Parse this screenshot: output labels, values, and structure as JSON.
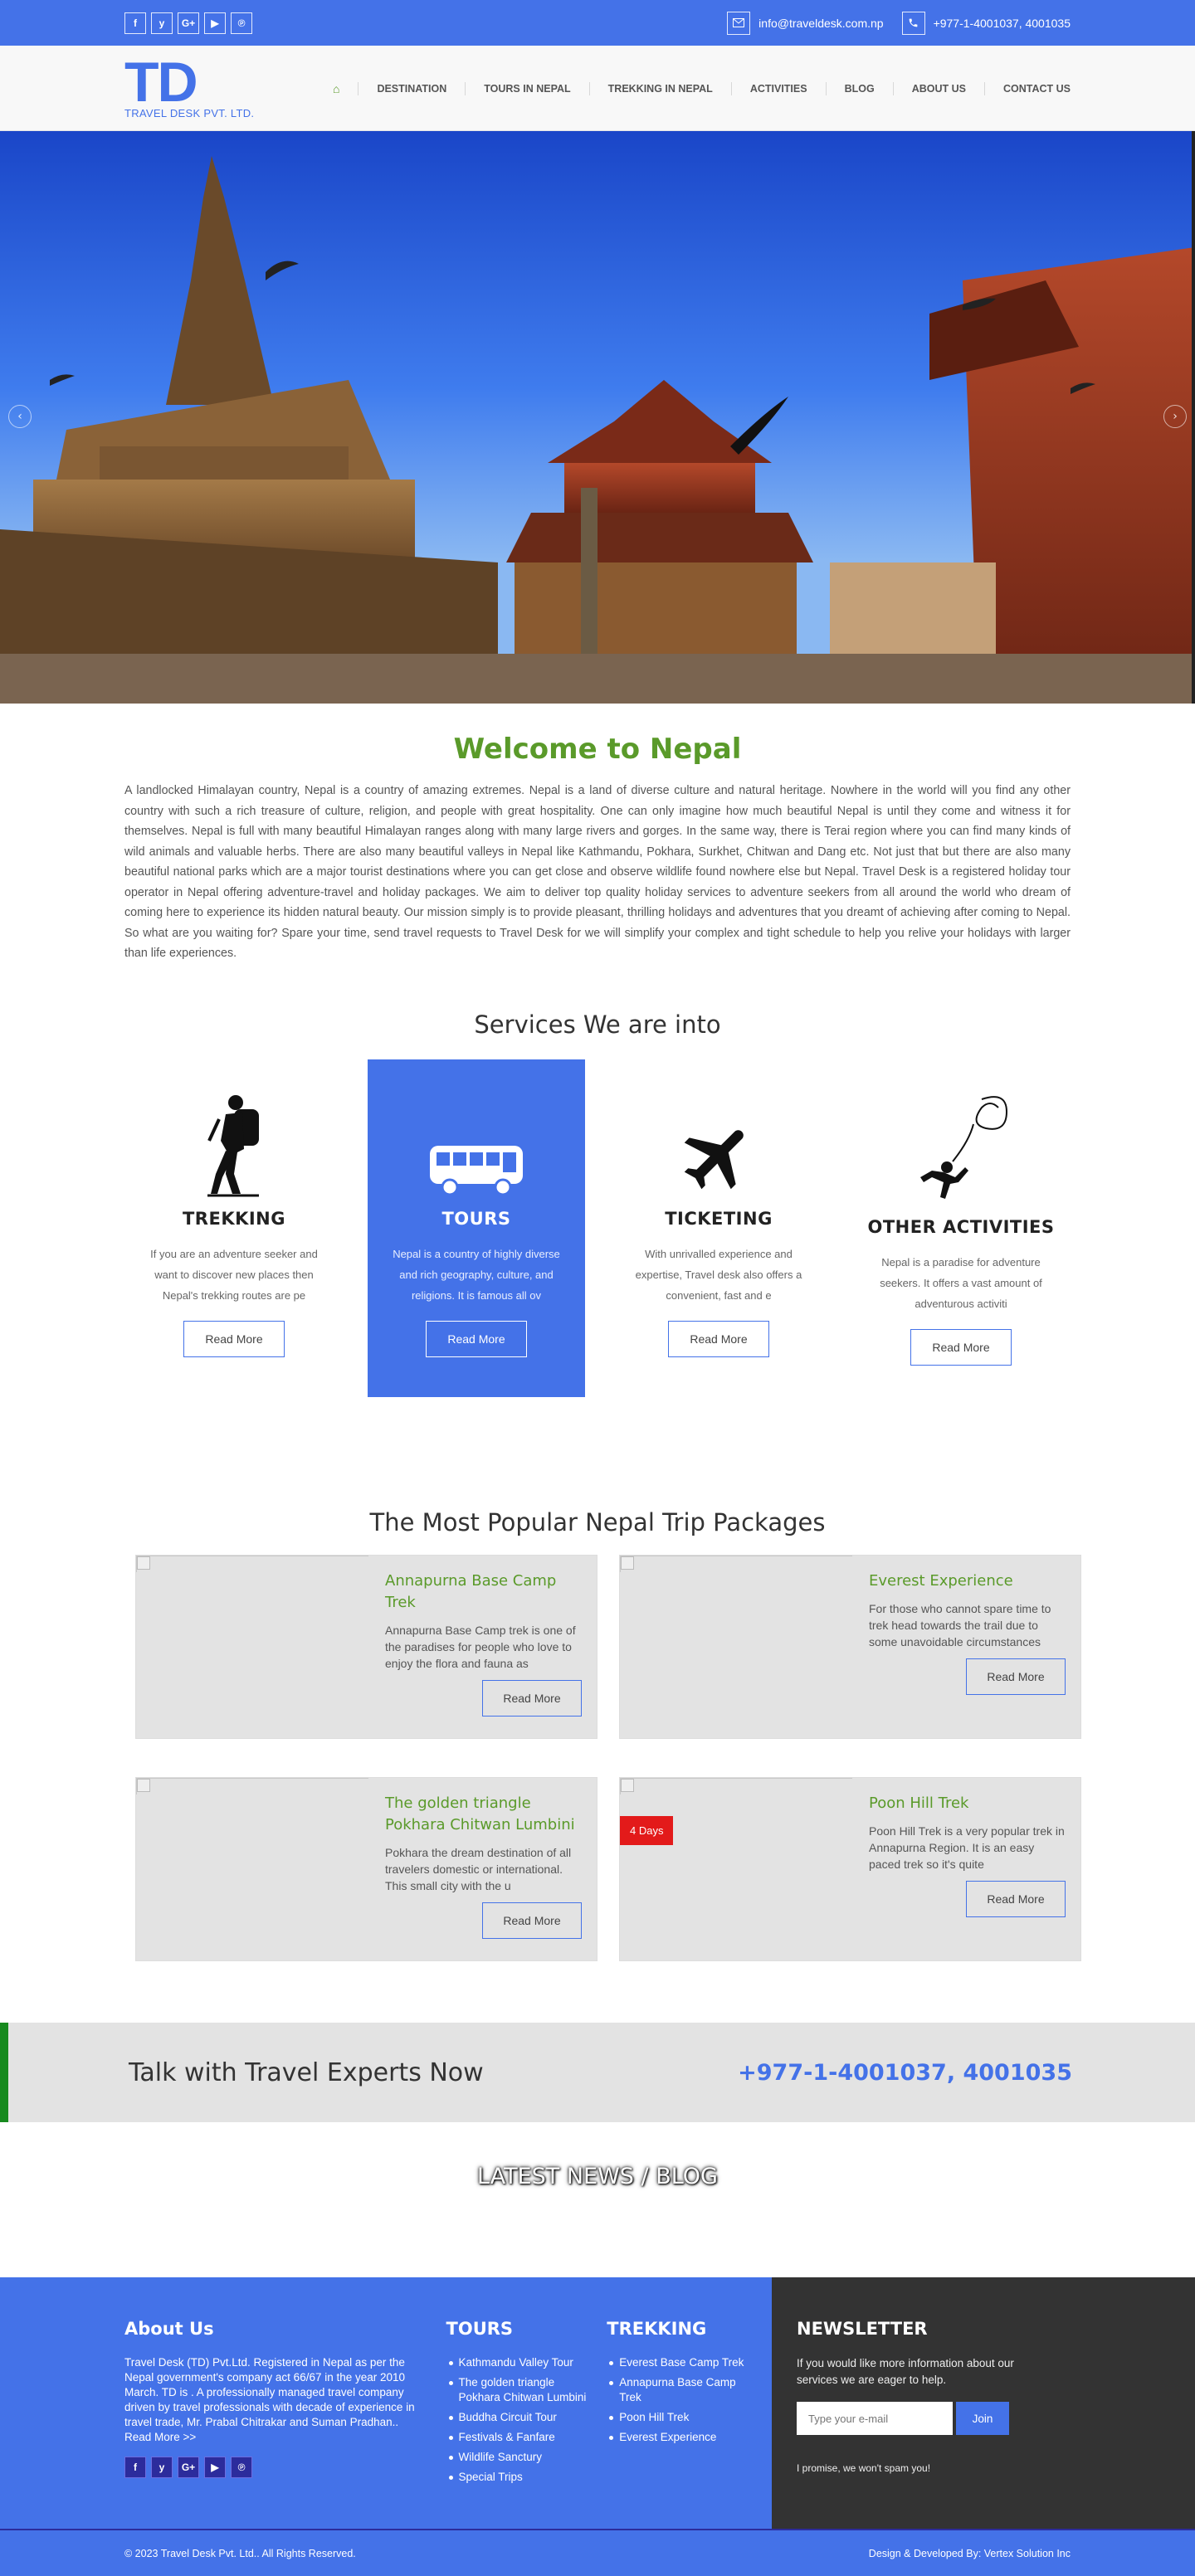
{
  "topbar": {
    "social": [
      {
        "icon": "facebook-icon",
        "glyph": "f"
      },
      {
        "icon": "twitter-icon",
        "glyph": "y"
      },
      {
        "icon": "google-plus-icon",
        "glyph": "G+"
      },
      {
        "icon": "youtube-icon",
        "glyph": "▶"
      },
      {
        "icon": "pinterest-icon",
        "glyph": "℗"
      }
    ],
    "email": "info@traveldesk.com.np",
    "phone": "+977-1-4001037, 4001035"
  },
  "header": {
    "logo_mark": "TD",
    "logo_sub": "TRAVEL DESK PVT. LTD.",
    "nav": [
      {
        "label": "⌂",
        "name": "home"
      },
      {
        "label": "DESTINATION",
        "name": "destination"
      },
      {
        "label": "TOURS IN NEPAL",
        "name": "tours-in-nepal"
      },
      {
        "label": "TREKKING IN NEPAL",
        "name": "trekking-in-nepal"
      },
      {
        "label": "ACTIVITIES",
        "name": "activities"
      },
      {
        "label": "BLOG",
        "name": "blog"
      },
      {
        "label": "ABOUT US",
        "name": "about-us"
      },
      {
        "label": "CONTACT US",
        "name": "contact-us"
      }
    ]
  },
  "hero": {
    "prev": "‹",
    "next": "›"
  },
  "welcome": {
    "title": "Welcome to Nepal",
    "text": "A landlocked Himalayan country, Nepal is a country of amazing extremes. Nepal is a land of diverse culture and natural heritage. Nowhere in the world will you find any other country with such a rich treasure of culture, religion, and people with great hospitality. One can only imagine how much beautiful Nepal is until they come and witness it for themselves. Nepal is full with many beautiful Himalayan ranges along with many large rivers and gorges. In the same way, there is Terai region where you can find many kinds of wild animals and valuable herbs. There are also many beautiful valleys in Nepal like Kathmandu, Pokhara, Surkhet, Chitwan and Dang etc. Not just that but there are also many beautiful national parks which are a major tourist destinations where you can get close and observe wildlife found nowhere else but Nepal. Travel Desk is a registered holiday tour operator in Nepal offering adventure-travel and holiday packages. We aim to deliver top quality holiday services to adventure seekers from all around the world who dream of coming here to experience its hidden natural beauty. Our mission simply is to provide pleasant, thrilling holidays and adventures that you dreamt of achieving after coming to Nepal. So what are you waiting for? Spare your time, send travel requests to Travel Desk for we will simplify your complex and tight schedule to help you relive your holidays with larger than life experiences."
  },
  "services": {
    "title": "Services We are into",
    "items": [
      {
        "name": "trekking",
        "icon": "hiker-icon",
        "title": "TREKKING",
        "text": "If you are an adventure seeker and want to discover new places then Nepal's trekking routes are pe",
        "button": "Read More"
      },
      {
        "name": "tours",
        "icon": "bus-icon",
        "title": "TOURS",
        "text": "Nepal is a country of highly diverse and rich geography, culture, and religions. It is famous all ov",
        "button": "Read More"
      },
      {
        "name": "ticketing",
        "icon": "airplane-icon",
        "title": "TICKETING",
        "text": "With unrivalled experience and expertise, Travel desk also offers a convenient, fast and e",
        "button": "Read More"
      },
      {
        "name": "other-activities",
        "icon": "bungee-icon",
        "title": "OTHER ACTIVITIES",
        "text": "Nepal is a paradise for adventure seekers. It offers a vast amount of adventurous activiti",
        "button": "Read More"
      }
    ]
  },
  "packages": {
    "title": "The Most Popular Nepal Trip Packages",
    "items": [
      {
        "title": "Annapurna Base Camp Trek",
        "text": "Annapurna Base Camp trek is one of the paradises for people who love to enjoy the flora and fauna as",
        "button": "Read More",
        "badge": ""
      },
      {
        "title": "Everest Experience",
        "text": "For those who cannot spare time to trek head towards the trail due to some unavoidable circumstances",
        "button": "Read More",
        "badge": ""
      },
      {
        "title": "The golden triangle Pokhara Chitwan Lumbini",
        "text": "Pokhara the dream destination of all travelers domestic or international. This small city with the u",
        "button": "Read More",
        "badge": ""
      },
      {
        "title": "Poon Hill Trek",
        "text": "Poon Hill Trek is a very popular trek in Annapurna Region. It is an easy paced trek so it's quite",
        "button": "Read More",
        "badge": "4 Days"
      }
    ]
  },
  "talk": {
    "lead": "Talk with Travel Experts Now",
    "phone": "+977-1-4001037, 4001035"
  },
  "blog": {
    "title": "LATEST NEWS / BLOG"
  },
  "footer": {
    "about": {
      "title": "About Us",
      "text": "Travel Desk (TD) Pvt.Ltd. Registered in Nepal as per the Nepal government's company act 66/67 in the year 2010 March. TD is . A professionally managed travel company driven by travel professionals with decade of experience in travel trade, Mr. Prabal Chitrakar and Suman Pradhan.. Read More >>"
    },
    "tours": {
      "title": "TOURS",
      "items": [
        "Kathmandu Valley Tour",
        "The golden triangle Pokhara Chitwan Lumbini",
        "Buddha Circuit Tour",
        "Festivals & Fanfare",
        "Wildlife Sanctury",
        "Special Trips"
      ]
    },
    "trekking": {
      "title": "TREKKING",
      "items": [
        "Everest Base Camp Trek",
        "Annapurna Base Camp Trek",
        "Poon Hill Trek",
        "Everest Experience"
      ]
    },
    "newsletter": {
      "title": "NEWSLETTER",
      "text": "If you would like more information about our services we are eager to help.",
      "placeholder": "Type your e-mail",
      "button": "Join",
      "note": "I promise, we won't spam you!"
    }
  },
  "copyright": {
    "left": "© 2023 Travel Desk Pvt. Ltd.. All Rights Reserved.",
    "right": "Design & Developed By: Vertex Solution Inc"
  },
  "colors": {
    "brand_blue": "#4472e8",
    "green": "#5a9a2a",
    "badge_red": "#e31a1a"
  }
}
